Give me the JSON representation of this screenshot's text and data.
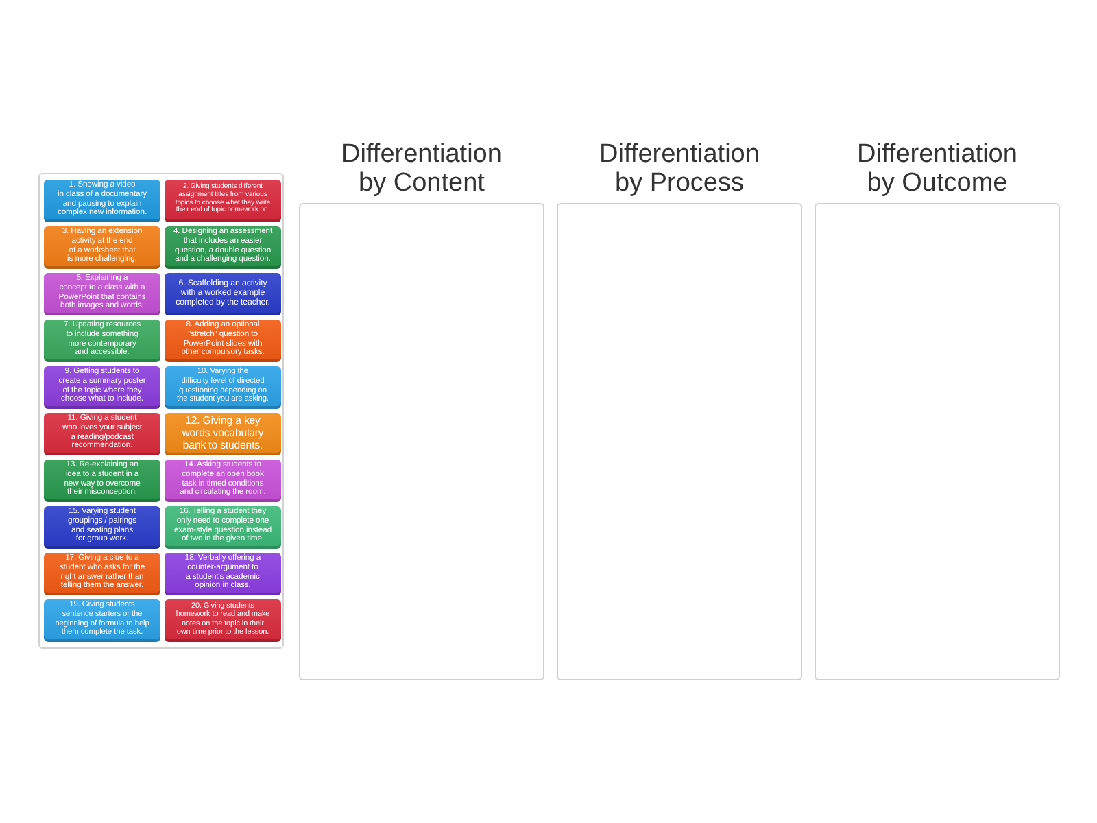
{
  "cards": [
    {
      "color": "#1f9ae0",
      "lines": [
        "1. Showing a video",
        "in class of a documentary",
        "and pausing to explain",
        "complex new information."
      ]
    },
    {
      "color": "#d9283c",
      "lines": [
        "2. Giving students different",
        "assignment titles from various",
        "topics to choose what they write",
        "their end of topic homework on."
      ]
    },
    {
      "color": "#f27c14",
      "lines": [
        "3. Having an extension",
        "activity at the end",
        "of a worksheet that",
        "is more challenging."
      ]
    },
    {
      "color": "#27994d",
      "lines": [
        "4. Designing an assessment",
        "that includes an easier",
        "question, a double question",
        "and a challenging question."
      ]
    },
    {
      "color": "#c450d4",
      "lines": [
        "5. Explaining a",
        "concept to a class with a",
        "PowerPoint that contains",
        "both images and words."
      ]
    },
    {
      "color": "#2a3ccb",
      "lines": [
        "6. Scaffolding an activity",
        "with a worked example",
        "completed by the teacher."
      ]
    },
    {
      "color": "#38a85c",
      "lines": [
        "7. Updating resources",
        "to include something",
        "more contemporary",
        "and accessible."
      ]
    },
    {
      "color": "#f25a12",
      "lines": [
        "8. Adding an optional",
        "\"stretch\" question to",
        "PowerPoint slides with",
        "other compulsory tasks."
      ]
    },
    {
      "color": "#8b3cdc",
      "lines": [
        "9. Getting students to",
        "create a summary poster",
        "of the topic where they",
        "choose what to include."
      ]
    },
    {
      "color": "#2aa2e8",
      "lines": [
        "10. Varying the",
        "difficulty level of directed",
        "questioning depending on",
        "the student you are asking."
      ]
    },
    {
      "color": "#d92a3c",
      "lines": [
        "11. Giving a student",
        "who loves your subject",
        "a reading/podcast",
        "recommendation."
      ]
    },
    {
      "color": "#f38a16",
      "lines": [
        "12. Giving a key",
        "words vocabulary",
        "bank to students."
      ]
    },
    {
      "color": "#27994d",
      "lines": [
        "13. Re-explaining an",
        "idea to a student in a",
        "new way to overcome",
        "their misconception."
      ]
    },
    {
      "color": "#c850d8",
      "lines": [
        "14. Asking students to",
        "complete an open book",
        "task in timed conditions",
        "and circulating the room."
      ]
    },
    {
      "color": "#2a3ccb",
      "lines": [
        "15. Varying student",
        "groupings / pairings",
        "and seating plans",
        "for group work."
      ]
    },
    {
      "color": "#3cb878",
      "lines": [
        "16. Telling a student they",
        "only need to complete one",
        "exam-style question instead",
        "of two in the given time."
      ]
    },
    {
      "color": "#f25a12",
      "lines": [
        "17. Giving a clue to a",
        "student who asks for the",
        "right answer rather than",
        "telling them the answer."
      ]
    },
    {
      "color": "#8b3ce0",
      "lines": [
        "18. Verbally offering a",
        "counter-argument to",
        "a student's academic",
        "opinion in class."
      ]
    },
    {
      "color": "#2aa2e8",
      "lines": [
        "19. Giving students",
        "sentence starters or the",
        "beginning of formula to help",
        "them complete the task."
      ]
    },
    {
      "color": "#d92a3c",
      "lines": [
        "20. Giving students",
        "homework to read and make",
        "notes on the topic in their",
        "own time prior to the lesson."
      ]
    }
  ],
  "groups": [
    {
      "title_lines": [
        "Differentiation",
        "by Content"
      ]
    },
    {
      "title_lines": [
        "Differentiation",
        "by Process"
      ]
    },
    {
      "title_lines": [
        "Differentiation",
        "by Outcome"
      ]
    }
  ]
}
